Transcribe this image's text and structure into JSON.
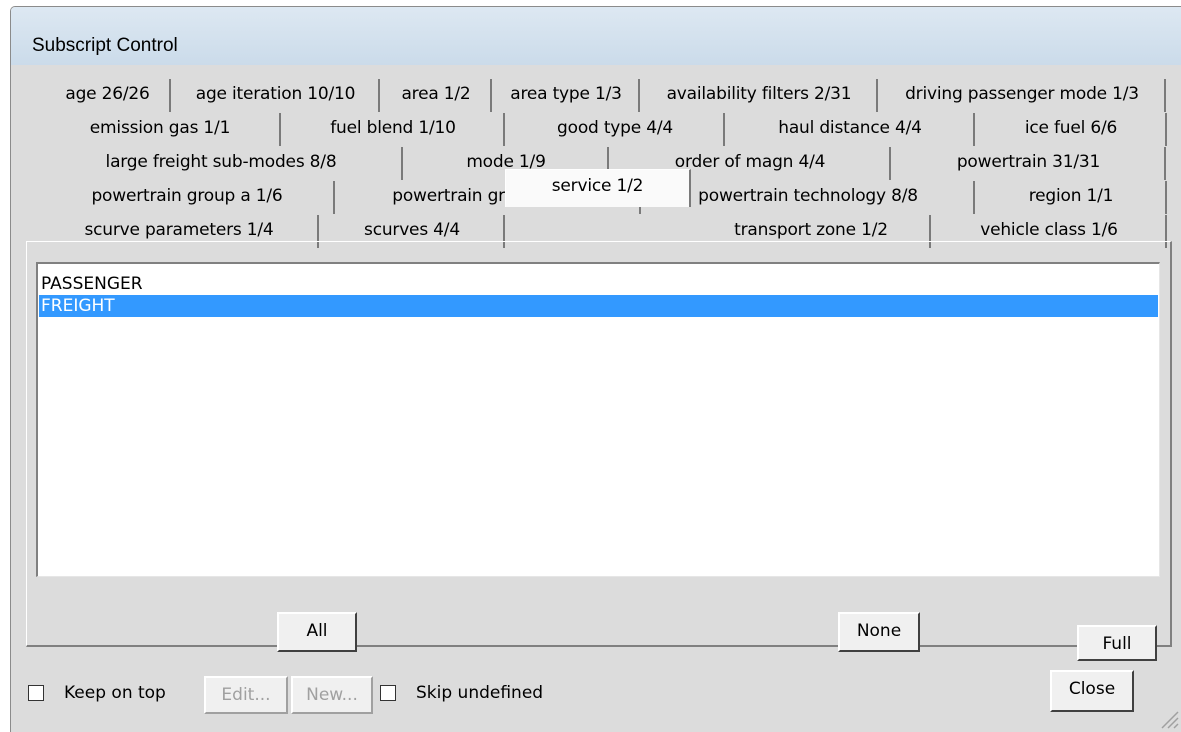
{
  "window": {
    "title": "Subscript Control"
  },
  "tabs": {
    "row1": [
      "age  26/26",
      "age iteration  10/10",
      "area  1/2",
      "area type  1/3",
      "availability filters  2/31",
      "driving passenger mode  1/3"
    ],
    "row2": [
      "emission gas  1/1",
      "fuel blend  1/10",
      "good type  4/4",
      "haul distance  4/4",
      "ice fuel  6/6"
    ],
    "row3": [
      "large freight sub-modes  8/8",
      "mode  1/9",
      "order of magn  4/4",
      "powertrain  31/31"
    ],
    "row4": [
      "powertrain group a  1/6",
      "powertrain group b  1/9",
      "powertrain technology  8/8",
      "region  1/1"
    ],
    "row5": [
      "scurve parameters  1/4",
      "scurves  4/4",
      "service  1/2",
      "transport zone  1/2",
      "vehicle class  1/6"
    ],
    "selected": "service  1/2"
  },
  "list": {
    "items": [
      "PASSENGER",
      "FREIGHT"
    ],
    "selected": "FREIGHT"
  },
  "buttons": {
    "all": "All",
    "none": "None",
    "full": "Full",
    "edit": "Edit...",
    "new": "New...",
    "close": "Close"
  },
  "checkboxes": {
    "keep_on_top": {
      "label": "Keep on top",
      "checked": false
    },
    "skip_undefined": {
      "label": "Skip undefined",
      "checked": false
    }
  },
  "colors": {
    "selection": "#3399ff",
    "titlebar": "#cfdeed"
  }
}
